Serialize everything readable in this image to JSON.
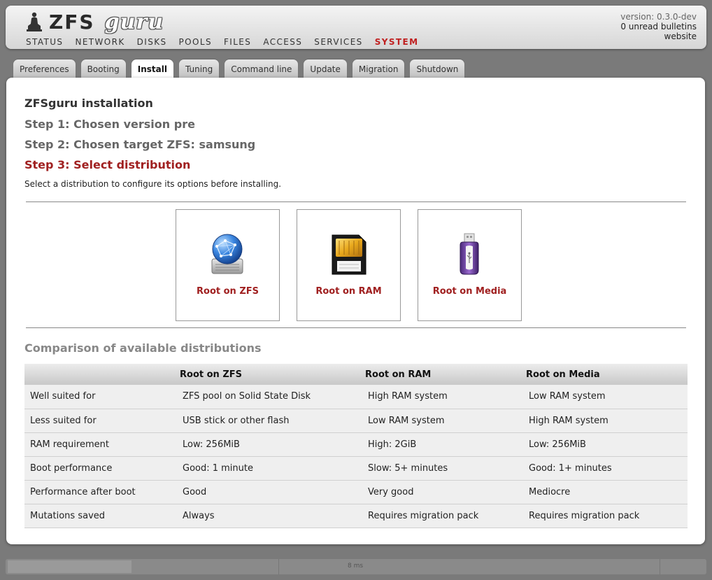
{
  "header": {
    "logo_zfs": "ZFS",
    "logo_guru": "guru",
    "version": "version: 0.3.0-dev",
    "bulletins": "0 unread bulletins",
    "website": "website"
  },
  "nav": [
    "STATUS",
    "NETWORK",
    "DISKS",
    "POOLS",
    "FILES",
    "ACCESS",
    "SERVICES",
    "SYSTEM"
  ],
  "tabs": [
    "Preferences",
    "Booting",
    "Install",
    "Tuning",
    "Command line",
    "Update",
    "Migration",
    "Shutdown"
  ],
  "main": {
    "title": "ZFSguru installation",
    "step1": "Step 1: Chosen version pre",
    "step2": "Step 2: Chosen target ZFS: samsung",
    "step3": "Step 3: Select distribution",
    "description": "Select a distribution to configure its options before installing.",
    "distributions": [
      {
        "label": "Root on ZFS",
        "icon": "network-disk-icon"
      },
      {
        "label": "Root on RAM",
        "icon": "memory-card-icon"
      },
      {
        "label": "Root on Media",
        "icon": "usb-stick-icon"
      }
    ],
    "comparison_title": "Comparison of available distributions",
    "table": {
      "headers": [
        "",
        "Root on ZFS",
        "Root on RAM",
        "Root on Media"
      ],
      "rows": [
        [
          "Well suited for",
          "ZFS pool on Solid State Disk",
          "High RAM system",
          "Low RAM system"
        ],
        [
          "Less suited for",
          "USB stick or other flash",
          "Low RAM system",
          "High RAM system"
        ],
        [
          "RAM requirement",
          "Low: 256MiB",
          "High: 2GiB",
          "Low: 256MiB"
        ],
        [
          "Boot performance",
          "Good: 1 minute",
          "Slow: 5+ minutes",
          "Good: 1+ minutes"
        ],
        [
          "Performance after boot",
          "Good",
          "Very good",
          "Mediocre"
        ],
        [
          "Mutations saved",
          "Always",
          "Requires migration pack",
          "Requires migration pack"
        ]
      ]
    }
  },
  "statusbar": {
    "time": "8 ms"
  },
  "colors": {
    "accent_red": "#a02020",
    "nav_active": "#c02020"
  }
}
